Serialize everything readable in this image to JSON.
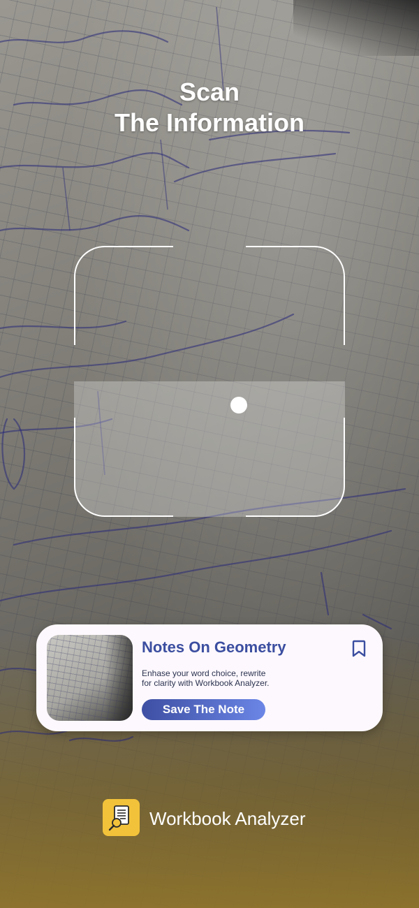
{
  "title": {
    "line1": "Scan",
    "line2": "The Information"
  },
  "card": {
    "title": "Notes On Geometry",
    "description_line1": "Enhase your word choice, rewrite",
    "description_line2": "for clarity with Workbook Analyzer.",
    "button_label": "Save The Note",
    "accent_color": "#3b4ea0"
  },
  "brand": {
    "name": "Workbook Analyzer",
    "icon": "document-search-icon",
    "icon_color": "#f2c23a"
  }
}
